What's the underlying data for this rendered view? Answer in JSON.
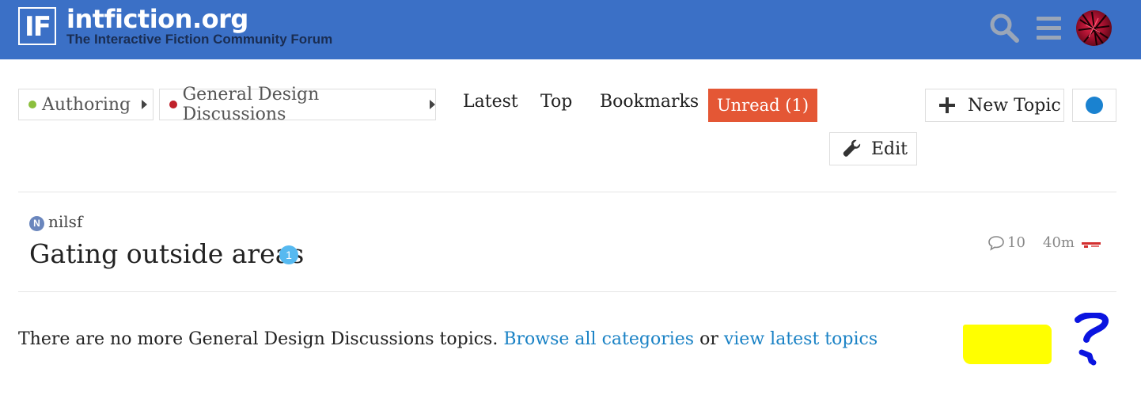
{
  "header": {
    "logo_text": "IF",
    "site_title": "intfiction.org",
    "site_subtitle": "The Interactive Fiction Community Forum",
    "icons": [
      "search-icon",
      "hamburger-menu-icon",
      "user-avatar"
    ]
  },
  "breadcrumbs": [
    {
      "label": "Authoring",
      "dot_color": "#8bbf3d"
    },
    {
      "label": "General Design Discussions",
      "dot_color": "#c0212b"
    }
  ],
  "nav": {
    "latest": "Latest",
    "top": "Top",
    "bookmarks": "Bookmarks",
    "unread": "Unread (1)"
  },
  "buttons": {
    "new_topic": "New Topic",
    "edit": "Edit"
  },
  "topic": {
    "poster_initial": "N",
    "poster": "nilsf",
    "title": "Gating outside areas",
    "unread_count": "1",
    "replies": "10",
    "activity": "40m"
  },
  "footer": {
    "text": "There are no more General Design Discussions topics.",
    "browse_link": "Browse all categories",
    "or_text": "or",
    "latest_link": "view latest topics"
  },
  "colors": {
    "header_bg": "#3b70c6",
    "unread_bg": "#e45735",
    "link": "#1a82c5",
    "notification_dot": "#1a82d0"
  }
}
